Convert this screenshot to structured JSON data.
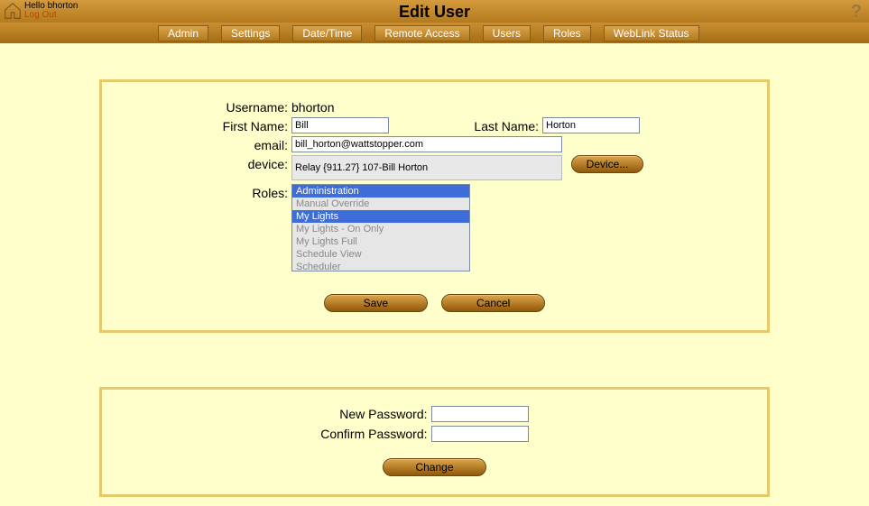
{
  "header": {
    "greeting": "Hello bhorton",
    "logout": "Log Out",
    "title": "Edit User"
  },
  "nav": [
    "Admin",
    "Settings",
    "Date/Time",
    "Remote Access",
    "Users",
    "Roles",
    "WebLink Status"
  ],
  "form": {
    "username_label": "Username:",
    "username_value": "bhorton",
    "firstname_label": "First Name:",
    "firstname_value": "Bill",
    "lastname_label": "Last Name:",
    "lastname_value": "Horton",
    "email_label": "email:",
    "email_value": "bill_horton@wattstopper.com",
    "device_label": "device:",
    "device_value": "Relay {911.27} 107-Bill Horton",
    "device_button": "Device...",
    "roles_label": "Roles:",
    "roles": [
      "Administration",
      "Manual Override",
      "My Lights",
      "My Lights - On Only",
      "My Lights Full",
      "Schedule View",
      "Scheduler"
    ],
    "roles_selected": [
      0,
      2
    ],
    "save": "Save",
    "cancel": "Cancel"
  },
  "password": {
    "new_label": "New Password:",
    "confirm_label": "Confirm Password:",
    "change": "Change"
  }
}
